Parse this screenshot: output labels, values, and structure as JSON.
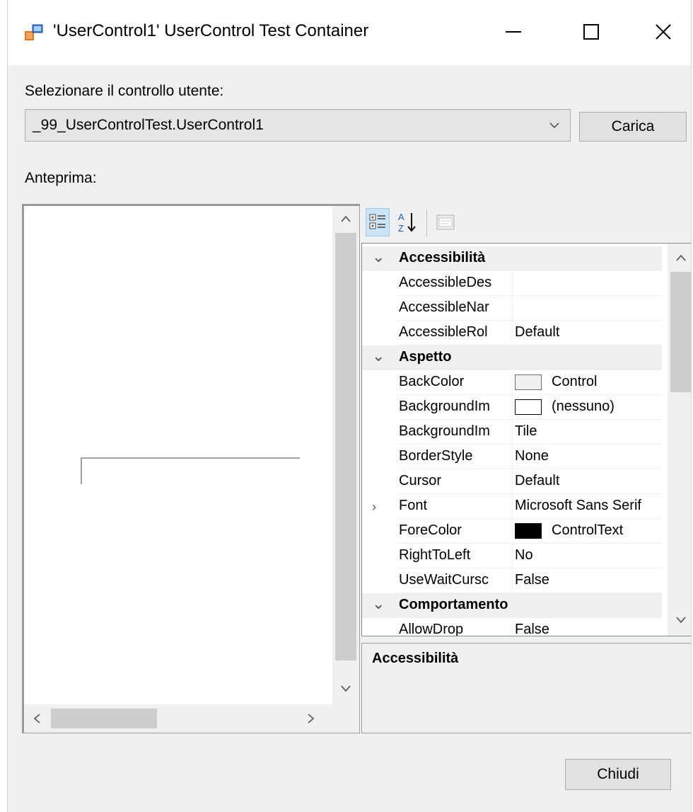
{
  "window": {
    "title": "'UserControl1' UserControl Test Container",
    "minimize_label": "—",
    "maximize_label": "☐",
    "close_label": "✕"
  },
  "selector": {
    "label": "Selezionare il controllo utente:",
    "value": "_99_UserControlTest.UserControl1",
    "load_button": "Carica"
  },
  "preview": {
    "label": "Anteprima:"
  },
  "property_grid": {
    "rows": [
      {
        "kind": "category",
        "expander": "⌄",
        "name": "Accessibilità"
      },
      {
        "kind": "property",
        "name": "AccessibleDes",
        "value": ""
      },
      {
        "kind": "property",
        "name": "AccessibleNar",
        "value": ""
      },
      {
        "kind": "property",
        "name": "AccessibleRol",
        "value": "Default"
      },
      {
        "kind": "category",
        "expander": "⌄",
        "name": "Aspetto"
      },
      {
        "kind": "property",
        "name": "BackColor",
        "value": "Control",
        "swatch": "#f0f0f0"
      },
      {
        "kind": "property",
        "name": "BackgroundIm",
        "value": "(nessuno)",
        "swatch": "#ffffff"
      },
      {
        "kind": "property",
        "name": "BackgroundIm",
        "value": "Tile"
      },
      {
        "kind": "property",
        "name": "BorderStyle",
        "value": "None"
      },
      {
        "kind": "property",
        "name": "Cursor",
        "value": "Default"
      },
      {
        "kind": "property",
        "expander": "›",
        "name": "Font",
        "value": "Microsoft Sans Serif"
      },
      {
        "kind": "property",
        "name": "ForeColor",
        "value": "ControlText",
        "swatch": "#000000"
      },
      {
        "kind": "property",
        "name": "RightToLeft",
        "value": "No"
      },
      {
        "kind": "property",
        "name": "UseWaitCursc",
        "value": "False"
      },
      {
        "kind": "category",
        "expander": "⌄",
        "name": "Comportamento"
      },
      {
        "kind": "property",
        "name": "AllowDrop",
        "value": "False"
      }
    ],
    "description_title": "Accessibilità"
  },
  "footer": {
    "close_button": "Chiudi"
  }
}
